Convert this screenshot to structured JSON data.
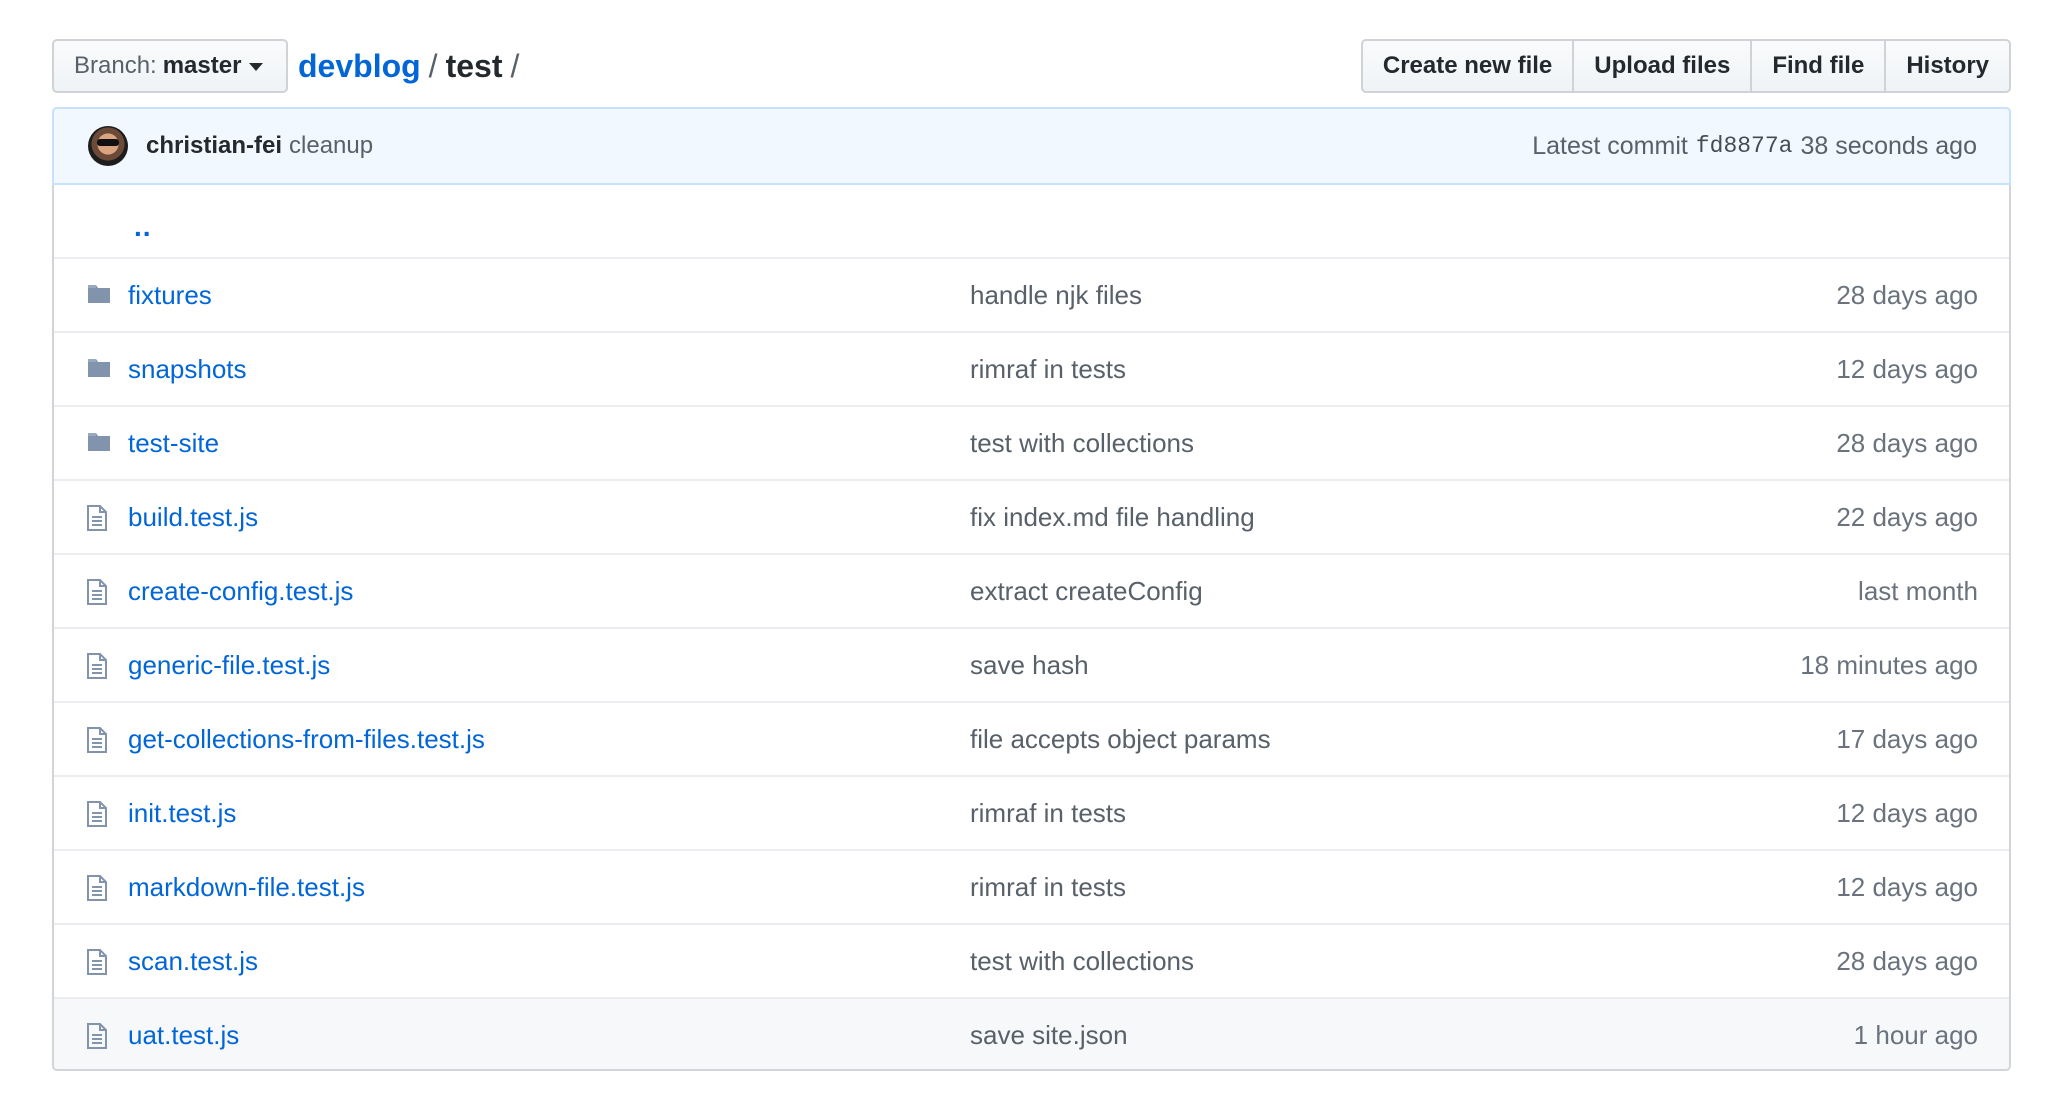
{
  "branch": {
    "prefix": "Branch:",
    "name": "master"
  },
  "breadcrumb": {
    "repo": "devblog",
    "separator": "/",
    "current": "test",
    "trailing": "/"
  },
  "actions": [
    {
      "label": "Create new file"
    },
    {
      "label": "Upload files"
    },
    {
      "label": "Find file"
    },
    {
      "label": "History"
    }
  ],
  "commit": {
    "author": "christian-fei",
    "message": "cleanup",
    "latest_label": "Latest commit",
    "sha": "fd8877a",
    "age": "38 seconds ago"
  },
  "updir": "..",
  "files": [
    {
      "type": "folder",
      "icon": "folder-icon",
      "name": "fixtures",
      "message": "handle njk files",
      "age": "28 days ago"
    },
    {
      "type": "folder",
      "icon": "folder-icon",
      "name": "snapshots",
      "message": "rimraf in tests",
      "age": "12 days ago"
    },
    {
      "type": "folder",
      "icon": "folder-icon",
      "name": "test-site",
      "message": "test with collections",
      "age": "28 days ago"
    },
    {
      "type": "file",
      "icon": "file-icon",
      "name": "build.test.js",
      "message": "fix index.md file handling",
      "age": "22 days ago"
    },
    {
      "type": "file",
      "icon": "file-icon",
      "name": "create-config.test.js",
      "message": "extract createConfig",
      "age": "last month"
    },
    {
      "type": "file",
      "icon": "file-icon",
      "name": "generic-file.test.js",
      "message": "save hash",
      "age": "18 minutes ago"
    },
    {
      "type": "file",
      "icon": "file-icon",
      "name": "get-collections-from-files.test.js",
      "message": "file accepts object params",
      "age": "17 days ago"
    },
    {
      "type": "file",
      "icon": "file-icon",
      "name": "init.test.js",
      "message": "rimraf in tests",
      "age": "12 days ago"
    },
    {
      "type": "file",
      "icon": "file-icon",
      "name": "markdown-file.test.js",
      "message": "rimraf in tests",
      "age": "12 days ago"
    },
    {
      "type": "file",
      "icon": "file-icon",
      "name": "scan.test.js",
      "message": "test with collections",
      "age": "28 days ago"
    },
    {
      "type": "file",
      "icon": "file-icon",
      "name": "uat.test.js",
      "message": "save site.json",
      "age": "1 hour ago"
    }
  ],
  "colors": {
    "link": "#0366d6",
    "commit_bg": "#f1f8ff",
    "hover_row": "#f6f8fa",
    "icon": "#8294ac"
  }
}
